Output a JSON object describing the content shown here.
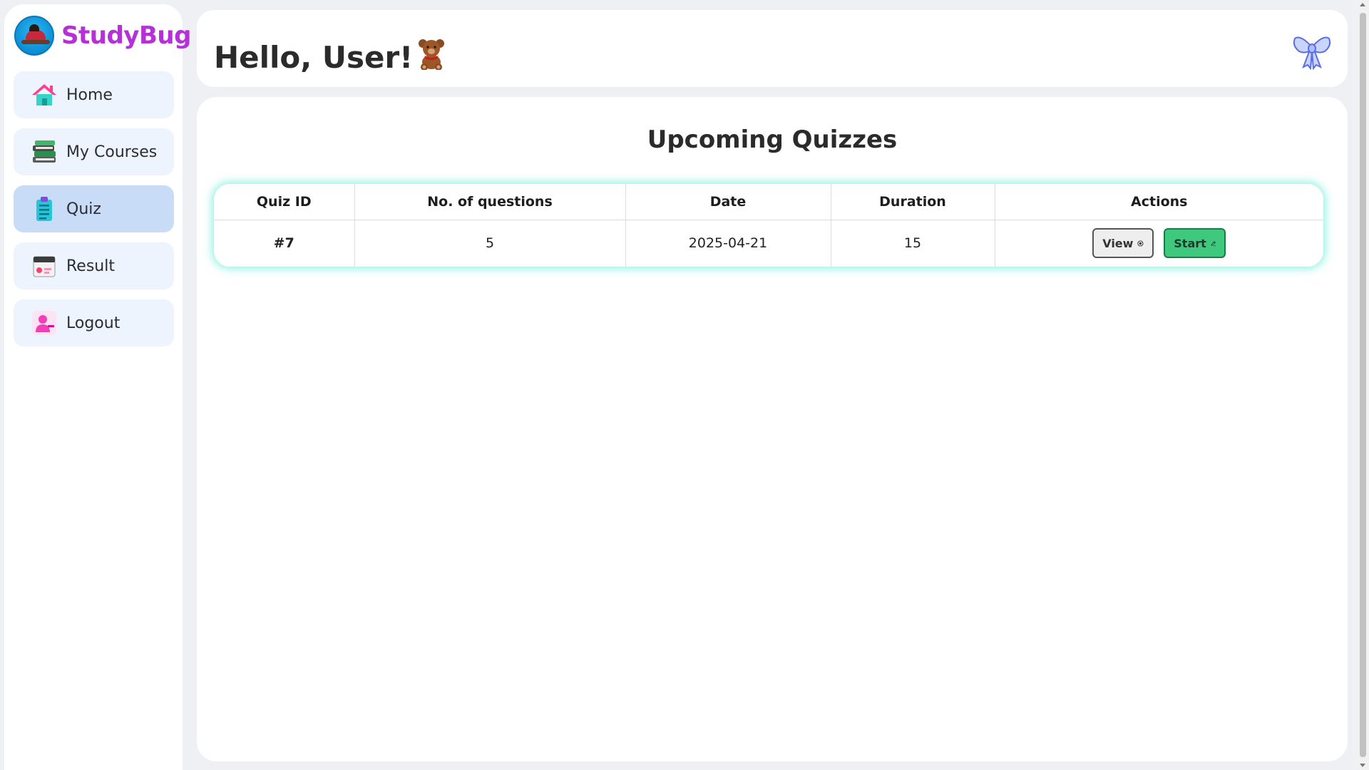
{
  "brand": {
    "name": "StudyBug",
    "logo": "ladybug-logo"
  },
  "sidebar": {
    "items": [
      {
        "label": "Home",
        "icon": "house-icon",
        "active": false
      },
      {
        "label": "My Courses",
        "icon": "books-icon",
        "active": false
      },
      {
        "label": "Quiz",
        "icon": "clipboard-icon",
        "active": true
      },
      {
        "label": "Result",
        "icon": "calendar-icon",
        "active": false
      },
      {
        "label": "Logout",
        "icon": "user-logout-icon",
        "active": false
      }
    ]
  },
  "header": {
    "greeting": "Hello, User!",
    "emoji_icon": "teddy-bear-icon",
    "action_icon": "ribbon-bow-icon"
  },
  "main": {
    "title": "Upcoming Quizzes",
    "table": {
      "columns": [
        "Quiz ID",
        "No. of questions",
        "Date",
        "Duration",
        "Actions"
      ],
      "rows": [
        {
          "quiz_id": "#7",
          "questions": "5",
          "date": "2025-04-21",
          "duration": "15",
          "view_label": "View",
          "start_label": "Start"
        }
      ]
    }
  },
  "colors": {
    "brand": "#b530d6",
    "active_nav": "#c8dcf7",
    "nav_bg": "#eef4fd",
    "table_glow": "#38e6c8",
    "start_button": "#3ec97e"
  }
}
